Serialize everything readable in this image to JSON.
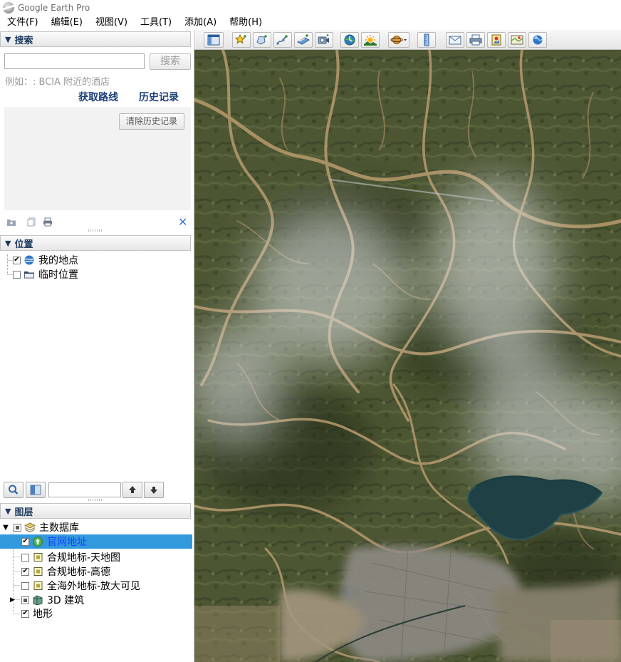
{
  "window": {
    "title": "Google Earth Pro"
  },
  "menu": [
    {
      "label": "文件(F)"
    },
    {
      "label": "编辑(E)"
    },
    {
      "label": "视图(V)"
    },
    {
      "label": "工具(T)"
    },
    {
      "label": "添加(A)"
    },
    {
      "label": "帮助(H)"
    }
  ],
  "search_panel": {
    "header": "搜索",
    "input_value": "",
    "search_button": "搜索",
    "hint": "例如：: BCIA 附近的酒店",
    "directions_link": "获取路线",
    "history_link": "历史记录",
    "clear_history_button": "清除历史记录"
  },
  "places_panel": {
    "header": "位置",
    "items": [
      {
        "label": "我的地点",
        "checked": true,
        "icon": "globe-icon"
      },
      {
        "label": "临时位置",
        "checked": false,
        "icon": "folder-icon"
      }
    ]
  },
  "layers_panel": {
    "header": "图层",
    "search_value": "",
    "items": [
      {
        "label": "主数据库",
        "state": "partial",
        "icon": "layers-icon",
        "expandable": true,
        "selected": false
      },
      {
        "label": "官网地址",
        "state": "checked",
        "icon": "arrow-up-circle-icon",
        "expandable": false,
        "selected": true
      },
      {
        "label": "合规地标-天地图",
        "state": "unchecked",
        "icon": "layer-box-icon",
        "expandable": false,
        "selected": false
      },
      {
        "label": "合规地标-高德",
        "state": "checked",
        "icon": "layer-box-icon",
        "expandable": false,
        "selected": false
      },
      {
        "label": "全海外地标-放大可见",
        "state": "unchecked",
        "icon": "layer-box-icon",
        "expandable": false,
        "selected": false
      },
      {
        "label": "3D 建筑",
        "state": "partial",
        "icon": "building-icon",
        "expandable": true,
        "selected": false
      },
      {
        "label": "地形",
        "state": "checked",
        "icon": "",
        "expandable": false,
        "selected": false
      }
    ]
  },
  "toolbar": {
    "buttons": [
      {
        "icon": "sidebar-toggle-icon"
      },
      {
        "icon": "add-placemark-icon"
      },
      {
        "icon": "add-polygon-icon"
      },
      {
        "icon": "add-path-icon"
      },
      {
        "icon": "add-image-overlay-icon"
      },
      {
        "icon": "record-tour-icon"
      },
      {
        "icon": "historical-imagery-icon"
      },
      {
        "icon": "sunlight-icon"
      },
      {
        "icon": "planets-icon"
      },
      {
        "icon": "ruler-icon"
      },
      {
        "icon": "email-icon"
      },
      {
        "icon": "print-icon"
      },
      {
        "icon": "save-image-icon"
      },
      {
        "icon": "view-in-maps-icon"
      },
      {
        "icon": "earth-gallery-icon"
      }
    ]
  },
  "colors": {
    "selected_row": "#3399dd",
    "link": "#1b3f7a",
    "panel_header_text": "#1e3a5f"
  }
}
